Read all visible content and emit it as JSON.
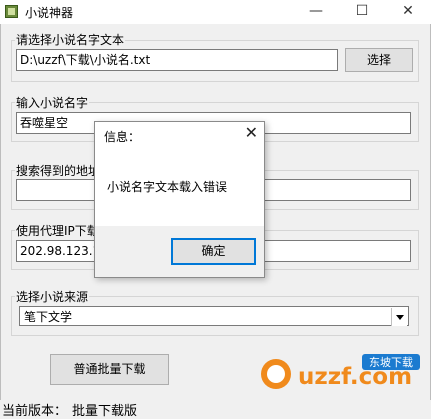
{
  "window": {
    "title": "小说神器",
    "minimize": "—",
    "maximize": "☐",
    "close": "✕"
  },
  "groups": {
    "file": {
      "label": "请选择小说名字文本",
      "path": "D:\\uzzf\\下载\\小说名.txt",
      "button": "选择"
    },
    "name": {
      "label": "输入小说名字",
      "value": "吞噬星空"
    },
    "address": {
      "label": "搜索得到的地址",
      "value": ""
    },
    "proxy": {
      "label": "使用代理IP下载",
      "value": "202.98.123.12"
    },
    "source": {
      "label": "选择小说来源",
      "selected": "笔下文学"
    }
  },
  "batch_button": "普通批量下载",
  "status": {
    "label": "当前版本：",
    "value": "批量下载版"
  },
  "dialog": {
    "title": "信息：",
    "message": "小说名字文本载入错误",
    "ok": "确定",
    "close": "✕"
  },
  "watermark": {
    "text": "uzzf.com",
    "badge": "东坡下载"
  }
}
